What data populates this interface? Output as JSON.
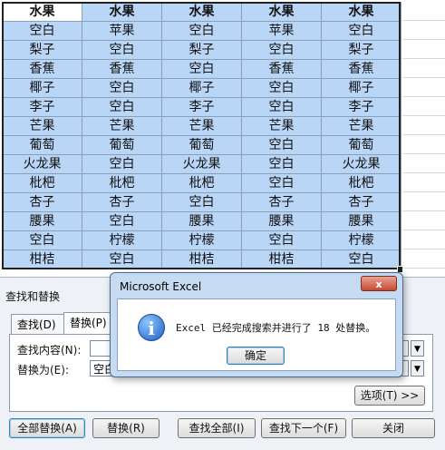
{
  "spreadsheet": {
    "headers": [
      "水果",
      "水果",
      "水果",
      "水果",
      "水果"
    ],
    "rows": [
      [
        "空白",
        "苹果",
        "空白",
        "苹果",
        "空白"
      ],
      [
        "梨子",
        "空白",
        "梨子",
        "空白",
        "梨子"
      ],
      [
        "香蕉",
        "香蕉",
        "空白",
        "香蕉",
        "香蕉"
      ],
      [
        "椰子",
        "空白",
        "椰子",
        "空白",
        "椰子"
      ],
      [
        "李子",
        "空白",
        "李子",
        "空白",
        "李子"
      ],
      [
        "芒果",
        "芒果",
        "芒果",
        "芒果",
        "芒果"
      ],
      [
        "葡萄",
        "葡萄",
        "葡萄",
        "空白",
        "葡萄"
      ],
      [
        "火龙果",
        "空白",
        "火龙果",
        "空白",
        "火龙果"
      ],
      [
        "枇杷",
        "枇杷",
        "枇杷",
        "空白",
        "枇杷"
      ],
      [
        "杏子",
        "杏子",
        "空白",
        "杏子",
        "杏子"
      ],
      [
        "腰果",
        "空白",
        "腰果",
        "腰果",
        "腰果"
      ],
      [
        "空白",
        "柠檬",
        "柠檬",
        "空白",
        "柠檬"
      ],
      [
        "柑桔",
        "空白",
        "柑桔",
        "柑桔",
        "空白"
      ]
    ],
    "colors": {
      "selection": "#bad6f7",
      "grid": "#8aa0b8"
    }
  },
  "find_replace": {
    "title": "查找和替换",
    "tabs": [
      "查找(D)",
      "替换(P)"
    ],
    "find_label": "查找内容(N):",
    "replace_label": "替换为(E):",
    "find_value": "",
    "replace_value": "空白",
    "options_button": "选项(T) >>",
    "buttons": {
      "replace_all": "全部替换(A)",
      "replace": "替换(R)",
      "find_all": "查找全部(I)",
      "find_next": "查找下一个(F)",
      "close": "关闭"
    }
  },
  "message_box": {
    "title": "Microsoft Excel",
    "icon": "info-icon",
    "text": "Excel 已经完成搜索并进行了 18 处替换。",
    "ok_button": "确定",
    "close_glyph": "x",
    "info_glyph": "i"
  }
}
